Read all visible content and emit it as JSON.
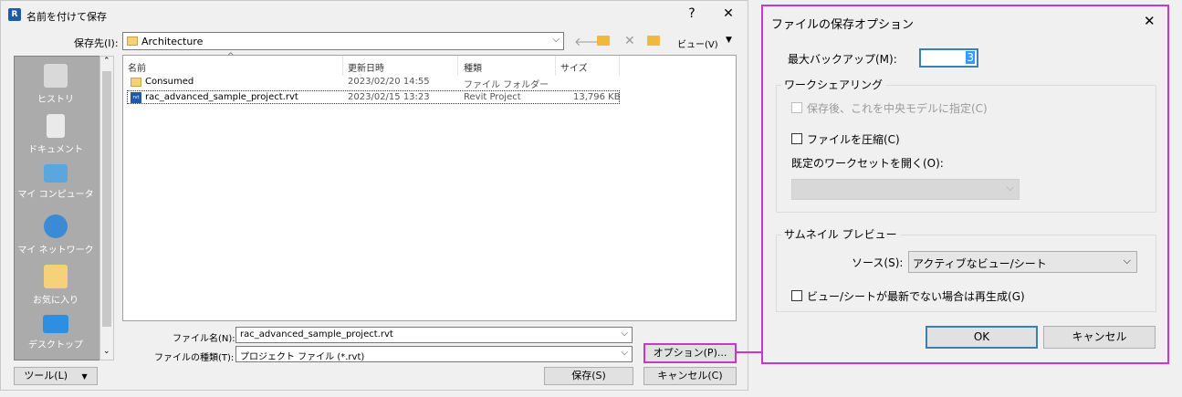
{
  "save_dialog": {
    "title": "名前を付けて保存",
    "help_btn": "?",
    "close_btn": "✕",
    "save_in_label": "保存先(I):",
    "save_in_value": "Architecture",
    "views_label": "ビュー(V)",
    "places": [
      {
        "label": "ヒストリ",
        "icon": "history-icon"
      },
      {
        "label": "ドキュメント",
        "icon": "documents-icon"
      },
      {
        "label": "マイ コンピュータ",
        "icon": "computer-icon"
      },
      {
        "label": "マイ ネットワーク",
        "icon": "network-icon"
      },
      {
        "label": "お気に入り",
        "icon": "favorites-icon"
      },
      {
        "label": "デスクトップ",
        "icon": "desktop-icon"
      }
    ],
    "columns": [
      "名前",
      "更新日時",
      "種類",
      "サイズ"
    ],
    "files": [
      {
        "name": "Consumed",
        "modified": "2023/02/20 14:55",
        "type": "ファイル フォルダー",
        "size": "",
        "icon": "folder-icon"
      },
      {
        "name": "rac_advanced_sample_project.rvt",
        "modified": "2023/02/15 13:23",
        "type": "Revit Project",
        "size": "13,796 KB",
        "icon": "rvt-file-icon"
      }
    ],
    "filename_label": "ファイル名(N):",
    "filename_value": "rac_advanced_sample_project.rvt",
    "filetype_label": "ファイルの種類(T):",
    "filetype_value": "プロジェクト ファイル (*.rvt)",
    "options_btn": "オプション(P)...",
    "save_btn": "保存(S)",
    "cancel_btn": "キャンセル(C)",
    "tools_btn": "ツール(L)"
  },
  "options_dialog": {
    "title": "ファイルの保存オプション",
    "close_btn": "✕",
    "max_backup_label": "最大バックアップ(M):",
    "max_backup_value": "3",
    "worksharing_title": "ワークシェアリング",
    "central_model_label": "保存後、これを中央モデルに指定(C)",
    "compress_label": "ファイルを圧縮(C)",
    "open_workset_label": "既定のワークセットを開く(O):",
    "open_workset_value": "",
    "thumbnail_title": "サムネイル プレビュー",
    "source_label": "ソース(S):",
    "source_value": "アクティブなビュー/シート",
    "regenerate_label": "ビュー/シートが最新でない場合は再生成(G)",
    "ok_btn": "OK",
    "cancel_btn": "キャンセル"
  },
  "colors": {
    "highlight": "#c837c8",
    "selection": "#99c9ef"
  }
}
